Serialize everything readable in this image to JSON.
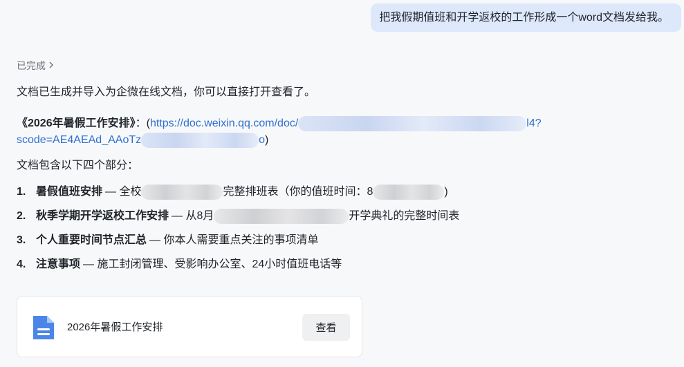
{
  "user_message": "把我假期值班和开学返校的工作形成一个word文档发给我。",
  "status": {
    "label": "已完成",
    "chevron_icon": "chevron-right-icon"
  },
  "answer": {
    "intro": "文档已生成并导入为企微在线文档，你可以直接打开查看了。",
    "doc_title": "《2026年暑假工作安排》",
    "doc_colon": "：(",
    "link_part1": "https://doc.weixin.qq.com/doc/",
    "link_part1_tail": "l4?",
    "link_part2": "scode=AE4AEAd_AAoTz",
    "link_part2_tail": "o",
    "link_close": ")",
    "sections_intro": "文档包含以下四个部分：",
    "sections": [
      {
        "num": "1.",
        "title": "暑假值班安排",
        "desc_a": "— 全校",
        "desc_b": "完整排班表（你的值班时间：8",
        "desc_c": ")"
      },
      {
        "num": "2.",
        "title": "秋季学期开学返校工作安排",
        "desc_a": "— 从8月",
        "desc_b": "开学典礼的完整时间表",
        "desc_c": ""
      },
      {
        "num": "3.",
        "title": "个人重要时间节点汇总",
        "desc_a": "— 你本人需要重点关注的事项清单",
        "desc_b": "",
        "desc_c": ""
      },
      {
        "num": "4.",
        "title": "注意事项",
        "desc_a": "— 施工封闭管理、受影响办公室、24小时值班电话等",
        "desc_b": "",
        "desc_c": ""
      }
    ]
  },
  "card": {
    "icon": "document-icon",
    "title": "2026年暑假工作安排",
    "view_label": "查看"
  },
  "colors": {
    "link": "#2e6fd0",
    "user_bubble": "#dde8fb",
    "doc_icon": "#4a86e8"
  }
}
